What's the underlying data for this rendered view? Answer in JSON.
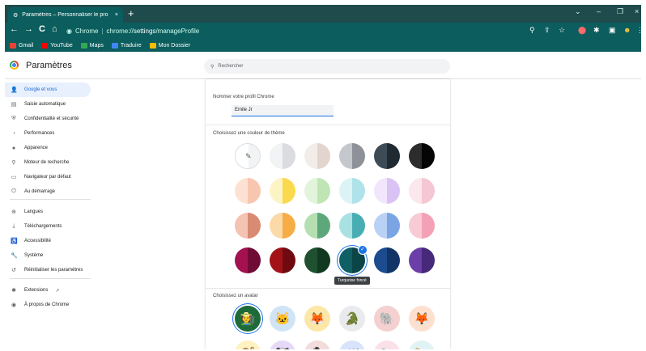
{
  "tab": {
    "title": "Paramètres – Personnaliser le pro",
    "close": "×",
    "new": "+"
  },
  "window_controls": [
    "⌄",
    "–",
    "❐",
    "×"
  ],
  "toolbar": {
    "back": "←",
    "forward": "→",
    "reload": "C",
    "home": "⌂",
    "site_label": "Chrome",
    "url_prefix": "chrome://",
    "url_bold": "settings",
    "url_suffix": "/manageProfile"
  },
  "bookmarks": [
    {
      "label": "Gmail",
      "color": "#ea4335"
    },
    {
      "label": "YouTube",
      "color": "#ff0000"
    },
    {
      "label": "Maps",
      "color": "#34a853"
    },
    {
      "label": "Traduire",
      "color": "#4285f4"
    },
    {
      "label": "Mon Dossier",
      "color": "#fbbc05"
    }
  ],
  "header": {
    "title": "Paramètres",
    "search_placeholder": "Rechercher"
  },
  "sidebar": {
    "items": [
      {
        "icon": "👤",
        "label": "Google et vous",
        "active": true
      },
      {
        "icon": "▤",
        "label": "Saisie automatique"
      },
      {
        "icon": "⛨",
        "label": "Confidentialité et sécurité"
      },
      {
        "icon": "◔",
        "label": "Performances"
      },
      {
        "icon": "●",
        "label": "Apparence"
      },
      {
        "icon": "⚲",
        "label": "Moteur de recherche"
      },
      {
        "icon": "▭",
        "label": "Navigateur par défaut"
      },
      {
        "icon": "⏻",
        "label": "Au démarrage"
      },
      {
        "icon": "⊕",
        "label": "Langues"
      },
      {
        "icon": "⤓",
        "label": "Téléchargements"
      },
      {
        "icon": "♿",
        "label": "Accessibilité"
      },
      {
        "icon": "🔧",
        "label": "Système"
      },
      {
        "icon": "↺",
        "label": "Réinitialiser les paramètres"
      },
      {
        "icon": "✱",
        "label": "Extensions",
        "ext": "↗"
      },
      {
        "icon": "◉",
        "label": "À propos de Chrome"
      }
    ]
  },
  "profile": {
    "name_label": "Nommer votre profil Chrome",
    "name_value": "Emile Jr",
    "theme_label": "Choisissez une couleur de thème",
    "selected_tooltip": "Turquoise foncé",
    "avatar_label": "Choisissez un avatar",
    "swatches": [
      [
        [
          "#ffffff",
          "#f1f3f4"
        ],
        [
          "#f1f3f4",
          "#dadce0"
        ],
        [
          "#f3ede9",
          "#e3d5cd"
        ],
        [
          "#c4c7cc",
          "#8e9197"
        ],
        [
          "#3c4b55",
          "#202a30"
        ],
        [
          "#2c2c2c",
          "#050505"
        ]
      ],
      [
        [
          "#fde2d4",
          "#f8c6ae"
        ],
        [
          "#fdf4c6",
          "#fbd94c"
        ],
        [
          "#e2f4dc",
          "#bfe5b4"
        ],
        [
          "#dcf3f5",
          "#b0e2ea"
        ],
        [
          "#f1e6fb",
          "#d9c3f4"
        ],
        [
          "#fbe7ec",
          "#f5c6d3"
        ]
      ],
      [
        [
          "#f4c3b3",
          "#d98a72"
        ],
        [
          "#fbd9a8",
          "#f6ad46"
        ],
        [
          "#b6dfb1",
          "#5ea77a"
        ],
        [
          "#a9e1e3",
          "#49aeb4"
        ],
        [
          "#b9d1f5",
          "#7ba4e4"
        ],
        [
          "#f8cad4",
          "#f4a0b5"
        ]
      ],
      [
        [
          "#a31151",
          "#700b36"
        ],
        [
          "#a31218",
          "#6f0b10"
        ],
        [
          "#1f5131",
          "#103920"
        ],
        [
          "#0f5f64",
          "#0b4548"
        ],
        [
          "#1c4b8f",
          "#123366"
        ],
        [
          "#6c3fa8",
          "#472879"
        ]
      ]
    ],
    "selected_swatch": [
      3,
      3
    ],
    "avatars": [
      "🧑‍🌾",
      "🐱",
      "🦊",
      "🐊",
      "🐘",
      "🦊",
      "🐒",
      "🐼",
      "🐧",
      "🦋",
      "🐦",
      "🍉"
    ]
  }
}
